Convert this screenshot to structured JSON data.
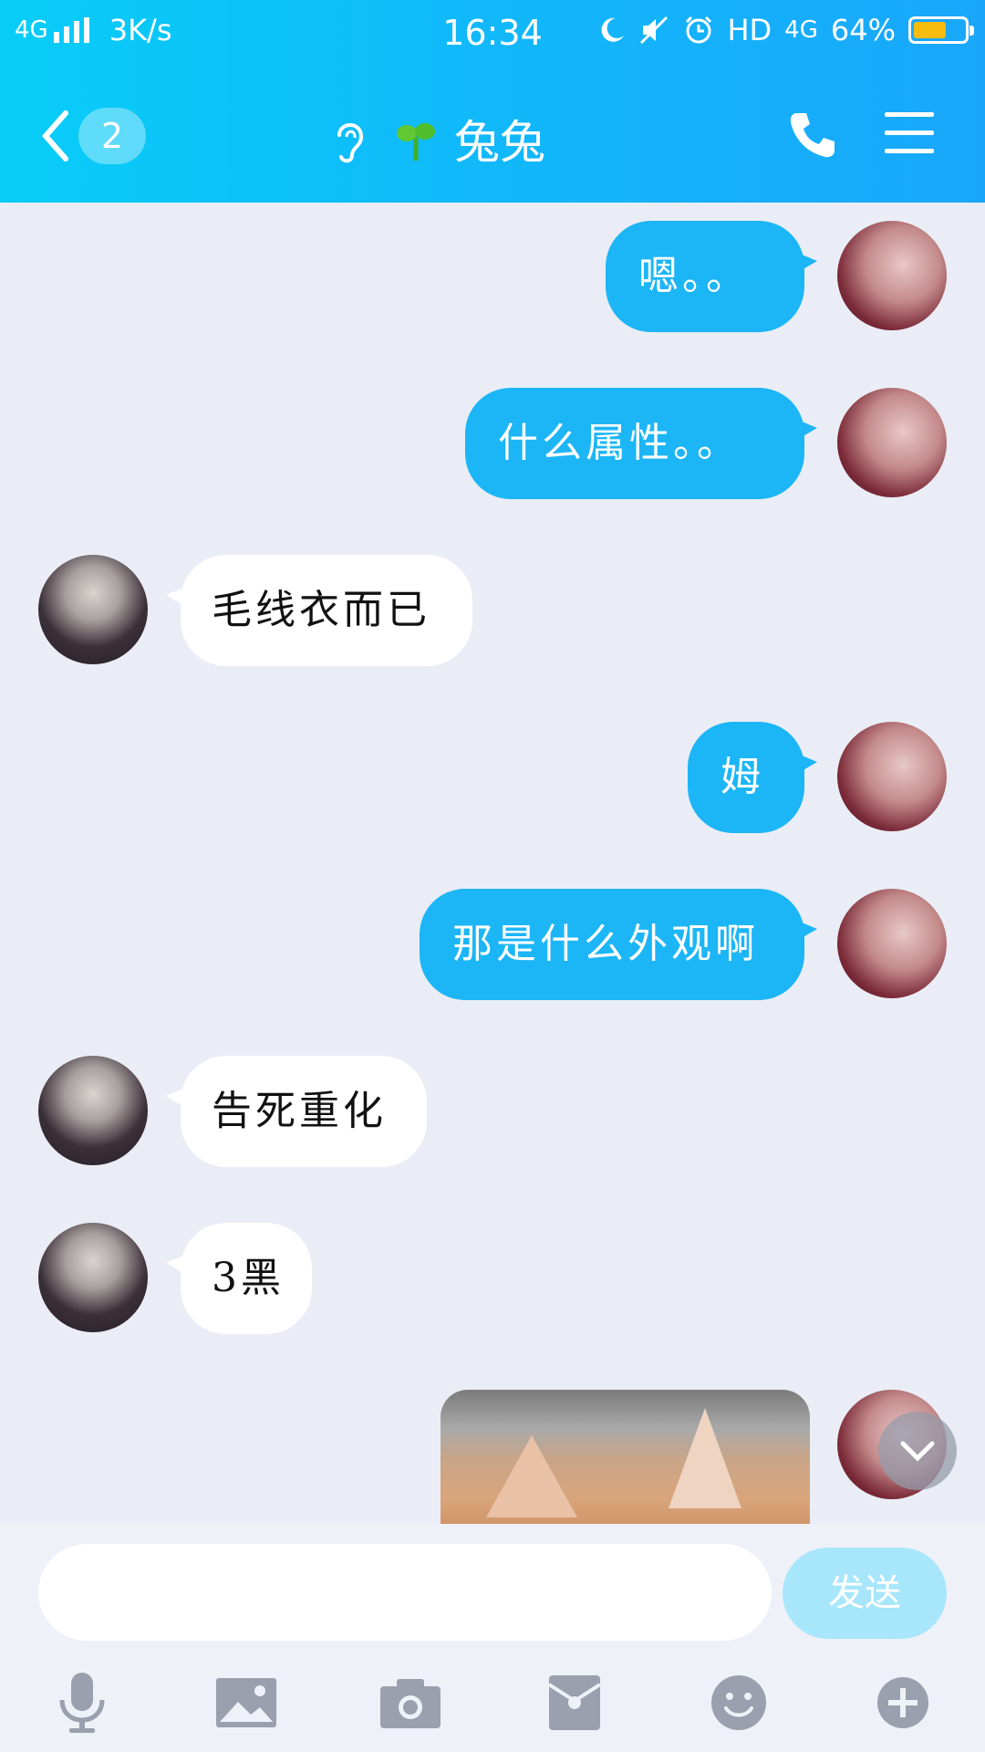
{
  "status_bar": {
    "network": "4G",
    "speed": "3K/s",
    "time": "16:34",
    "hd": "HD",
    "net2": "4G",
    "battery": "64%",
    "battery_level": 0.64
  },
  "nav": {
    "unread_badge": "2",
    "contact_name": "兔兔"
  },
  "messages": [
    {
      "side": "me",
      "text": "嗯。。"
    },
    {
      "side": "me",
      "text": "什么属性。。"
    },
    {
      "side": "them",
      "text": "毛线衣而已"
    },
    {
      "side": "me",
      "text": "姆"
    },
    {
      "side": "me",
      "text": "那是什么外观啊"
    },
    {
      "side": "them",
      "text": "告死重化"
    },
    {
      "side": "them",
      "text": "3黑"
    }
  ],
  "input": {
    "placeholder": "",
    "value": "",
    "send_label": "发送"
  },
  "colors": {
    "header": "#12b6fa",
    "my_bubble": "#1cb6f6",
    "their_bubble": "#ffffff",
    "background": "#eaedf5"
  },
  "toolbar_icons": [
    "microphone-icon",
    "image-icon",
    "camera-icon",
    "red-packet-icon",
    "emoji-icon",
    "plus-icon"
  ]
}
